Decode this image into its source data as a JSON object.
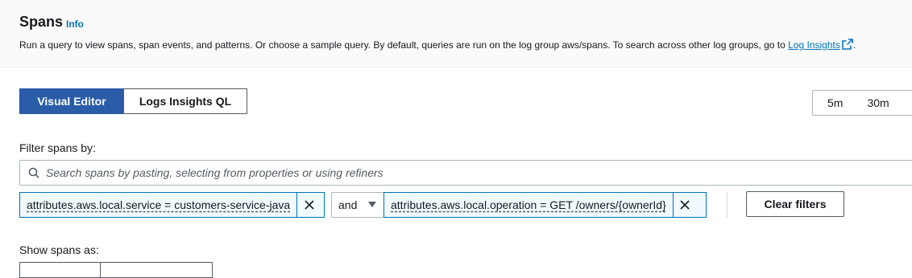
{
  "header": {
    "title": "Spans",
    "info": "Info",
    "description": "Run a query to view spans, span events, and patterns. Or choose a sample query. By default, queries are run on the log group aws/spans. To search across other log groups, go to",
    "link": "Log Insights",
    "trailing": "."
  },
  "editor_tabs": [
    {
      "label": "Visual Editor",
      "active": true
    },
    {
      "label": "Logs Insights QL",
      "active": false
    }
  ],
  "time_range": [
    "5m",
    "30m"
  ],
  "filter": {
    "label": "Filter spans by:",
    "search_placeholder": "Search spans by pasting, selecting from properties or using refiners",
    "tokens": [
      "attributes.aws.local.service = customers-service-java",
      "attributes.aws.local.operation = GET /owners/{ownerId}"
    ],
    "operator": "and",
    "clear_label": "Clear filters"
  },
  "show_spans_label": "Show spans as:",
  "colors": {
    "accent": "#2a5ca8",
    "link": "#0073bb",
    "token_border": "#0073bb"
  }
}
